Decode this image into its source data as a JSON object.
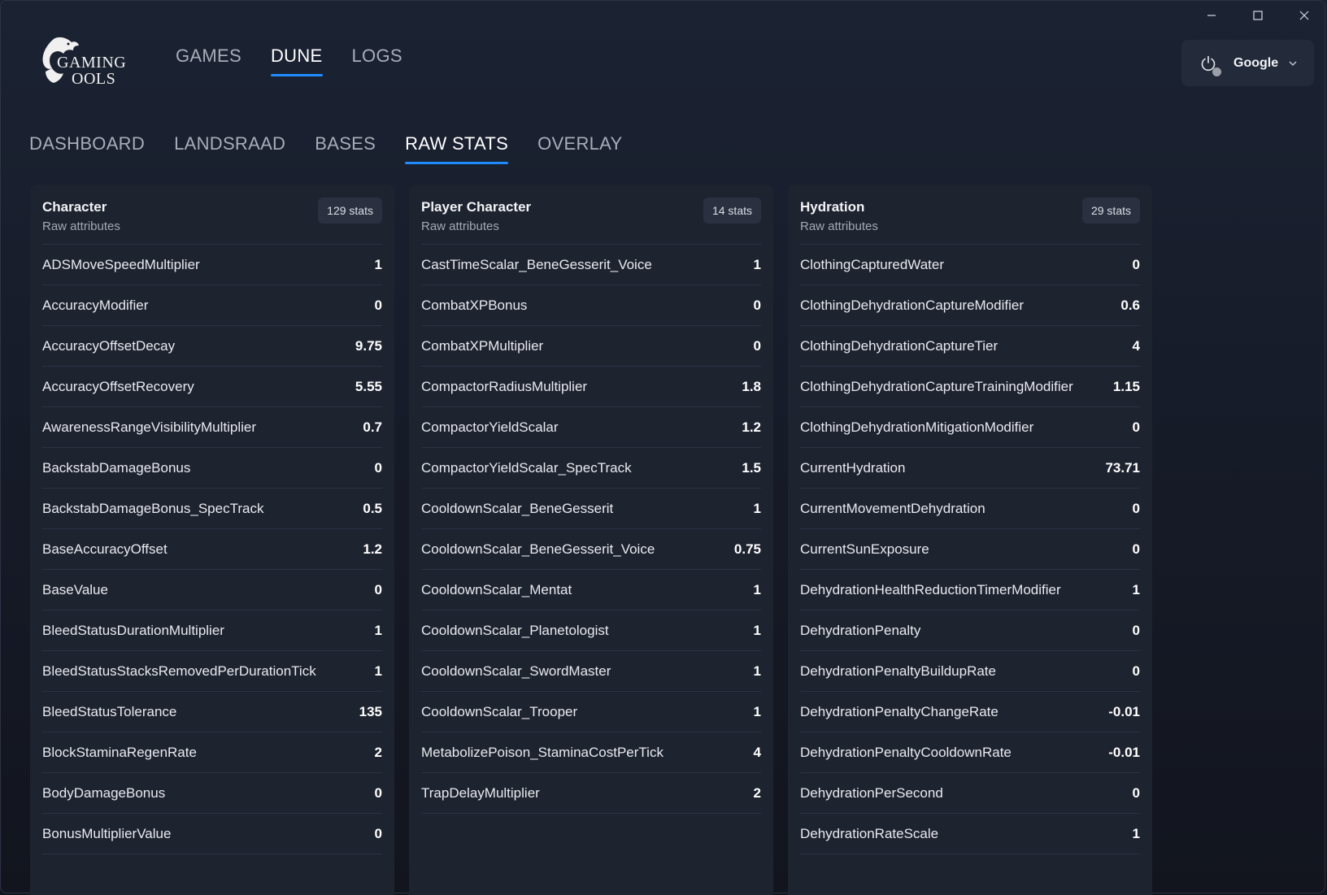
{
  "window": {
    "minimize_icon": "minimize-icon",
    "maximize_icon": "maximize-icon",
    "close_icon": "close-icon"
  },
  "logo": {
    "line1": "GAMING",
    "line2": "OOLS"
  },
  "top_nav": [
    {
      "label": "GAMES",
      "active": false
    },
    {
      "label": "DUNE",
      "active": true
    },
    {
      "label": "LOGS",
      "active": false
    }
  ],
  "account": {
    "name": "Google",
    "status_color": "#9b9fa7"
  },
  "sub_tabs": [
    {
      "label": "DASHBOARD",
      "active": false
    },
    {
      "label": "LANDSRAAD",
      "active": false
    },
    {
      "label": "BASES",
      "active": false
    },
    {
      "label": "RAW STATS",
      "active": true
    },
    {
      "label": "OVERLAY",
      "active": false
    }
  ],
  "accent_color": "#1f8bff",
  "panels": [
    {
      "title": "Character",
      "subtitle": "Raw attributes",
      "badge": "129 stats",
      "stats": [
        {
          "name": "ADSMoveSpeedMultiplier",
          "value": "1"
        },
        {
          "name": "AccuracyModifier",
          "value": "0"
        },
        {
          "name": "AccuracyOffsetDecay",
          "value": "9.75"
        },
        {
          "name": "AccuracyOffsetRecovery",
          "value": "5.55"
        },
        {
          "name": "AwarenessRangeVisibilityMultiplier",
          "value": "0.7"
        },
        {
          "name": "BackstabDamageBonus",
          "value": "0"
        },
        {
          "name": "BackstabDamageBonus_SpecTrack",
          "value": "0.5"
        },
        {
          "name": "BaseAccuracyOffset",
          "value": "1.2"
        },
        {
          "name": "BaseValue",
          "value": "0"
        },
        {
          "name": "BleedStatusDurationMultiplier",
          "value": "1"
        },
        {
          "name": "BleedStatusStacksRemovedPerDurationTick",
          "value": "1"
        },
        {
          "name": "BleedStatusTolerance",
          "value": "135"
        },
        {
          "name": "BlockStaminaRegenRate",
          "value": "2"
        },
        {
          "name": "BodyDamageBonus",
          "value": "0"
        },
        {
          "name": "BonusMultiplierValue",
          "value": "0"
        }
      ]
    },
    {
      "title": "Player Character",
      "subtitle": "Raw attributes",
      "badge": "14 stats",
      "stats": [
        {
          "name": "CastTimeScalar_BeneGesserit_Voice",
          "value": "1"
        },
        {
          "name": "CombatXPBonus",
          "value": "0"
        },
        {
          "name": "CombatXPMultiplier",
          "value": "0"
        },
        {
          "name": "CompactorRadiusMultiplier",
          "value": "1.8"
        },
        {
          "name": "CompactorYieldScalar",
          "value": "1.2"
        },
        {
          "name": "CompactorYieldScalar_SpecTrack",
          "value": "1.5"
        },
        {
          "name": "CooldownScalar_BeneGesserit",
          "value": "1"
        },
        {
          "name": "CooldownScalar_BeneGesserit_Voice",
          "value": "0.75"
        },
        {
          "name": "CooldownScalar_Mentat",
          "value": "1"
        },
        {
          "name": "CooldownScalar_Planetologist",
          "value": "1"
        },
        {
          "name": "CooldownScalar_SwordMaster",
          "value": "1"
        },
        {
          "name": "CooldownScalar_Trooper",
          "value": "1"
        },
        {
          "name": "MetabolizePoison_StaminaCostPerTick",
          "value": "4"
        },
        {
          "name": "TrapDelayMultiplier",
          "value": "2"
        }
      ]
    },
    {
      "title": "Hydration",
      "subtitle": "Raw attributes",
      "badge": "29 stats",
      "stats": [
        {
          "name": "ClothingCapturedWater",
          "value": "0"
        },
        {
          "name": "ClothingDehydrationCaptureModifier",
          "value": "0.6"
        },
        {
          "name": "ClothingDehydrationCaptureTier",
          "value": "4"
        },
        {
          "name": "ClothingDehydrationCaptureTrainingModifier",
          "value": "1.15"
        },
        {
          "name": "ClothingDehydrationMitigationModifier",
          "value": "0"
        },
        {
          "name": "CurrentHydration",
          "value": "73.71"
        },
        {
          "name": "CurrentMovementDehydration",
          "value": "0"
        },
        {
          "name": "CurrentSunExposure",
          "value": "0"
        },
        {
          "name": "DehydrationHealthReductionTimerModifier",
          "value": "1"
        },
        {
          "name": "DehydrationPenalty",
          "value": "0"
        },
        {
          "name": "DehydrationPenaltyBuildupRate",
          "value": "0"
        },
        {
          "name": "DehydrationPenaltyChangeRate",
          "value": "-0.01"
        },
        {
          "name": "DehydrationPenaltyCooldownRate",
          "value": "-0.01"
        },
        {
          "name": "DehydrationPerSecond",
          "value": "0"
        },
        {
          "name": "DehydrationRateScale",
          "value": "1"
        }
      ]
    }
  ]
}
